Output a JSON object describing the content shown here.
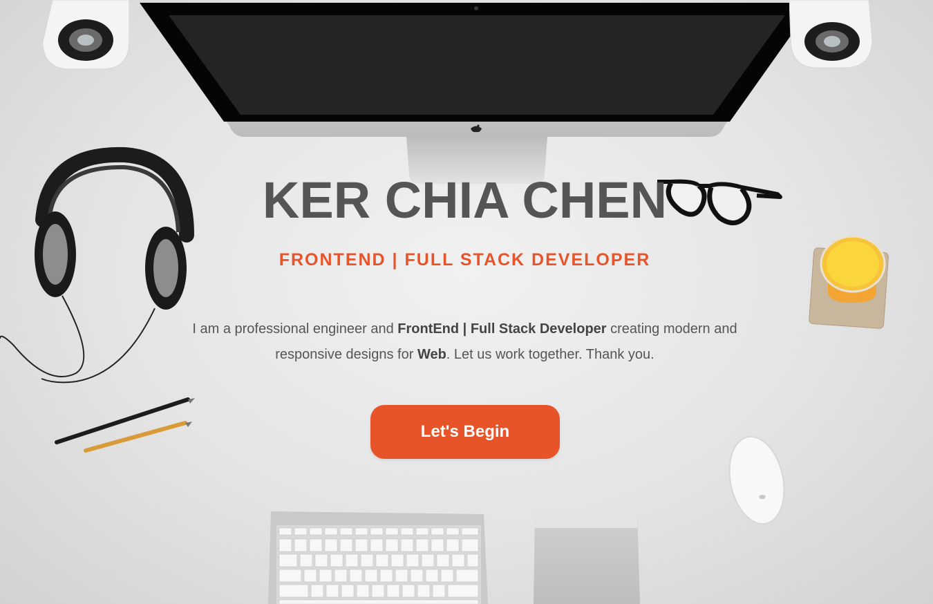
{
  "hero": {
    "name": "KER CHIA CHEN",
    "subtitle": "FRONTEND | FULL STACK DEVELOPER",
    "intro": {
      "part1": "I am a professional engineer and ",
      "bold1": "FrontEnd | Full Stack Developer",
      "part2": " creating modern and responsive designs for ",
      "bold2": "Web",
      "part3": ". Let us work together. Thank you."
    },
    "cta_label": "Let's Begin"
  },
  "colors": {
    "accent": "#e8542a",
    "heading": "#555555",
    "body_text": "#555555",
    "background": "#e6e6e6"
  },
  "decor": [
    "imac-image",
    "speaker-left-image",
    "speaker-right-image",
    "headphones-image",
    "glasses-image",
    "juice-glass-image",
    "pencils-image",
    "mouse-image",
    "keyboard-image",
    "trackpad-image"
  ]
}
